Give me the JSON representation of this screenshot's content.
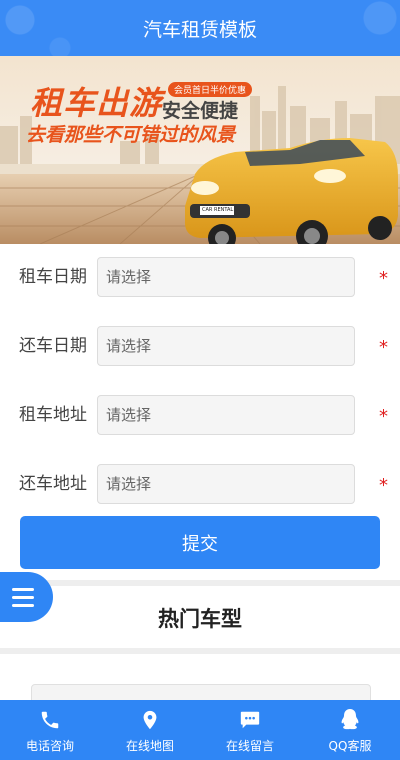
{
  "header": {
    "title": "汽车租赁模板"
  },
  "banner": {
    "headline": "租车出游",
    "tag": "会员首日半价优惠",
    "slogan": "安全便捷",
    "subline": "去看那些不可错过的风景",
    "plate": "CAR RENTAL"
  },
  "form": {
    "fields": [
      {
        "label": "租车日期",
        "placeholder": "请选择",
        "required": "*"
      },
      {
        "label": "还车日期",
        "placeholder": "请选择",
        "required": "*"
      },
      {
        "label": "租车地址",
        "placeholder": "请选择",
        "required": "*"
      },
      {
        "label": "还车地址",
        "placeholder": "请选择",
        "required": "*"
      }
    ],
    "submit_label": "提交"
  },
  "section": {
    "title": "热门车型"
  },
  "bottom_nav": {
    "items": [
      {
        "label": "电话咨询",
        "icon": "phone-icon"
      },
      {
        "label": "在线地图",
        "icon": "map-pin-icon"
      },
      {
        "label": "在线留言",
        "icon": "chat-icon"
      },
      {
        "label": "QQ客服",
        "icon": "qq-icon"
      }
    ]
  },
  "colors": {
    "primary": "#2f86f5",
    "required": "#e02020"
  }
}
